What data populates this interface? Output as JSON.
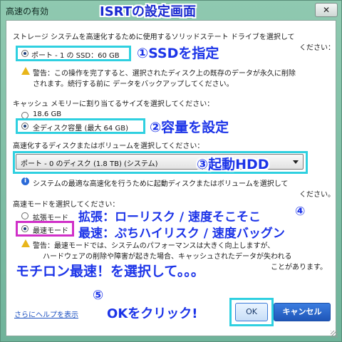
{
  "window": {
    "title": "高速の有効",
    "close_glyph": "✕"
  },
  "annotations": {
    "page_title": "ISRTの設定画面",
    "step1": "①SSDを指定",
    "step2": "②容量を設定",
    "step3": "③起動HDD",
    "step4": "④",
    "expansion_note": "拡張：ローリスク / 速度そこそこ",
    "fastest_note": "最速：ぷちハイリスク / 速度バッグン",
    "choose_fastest": "モチロン最速！を選択して。。。",
    "step5": "⑤",
    "click_ok": "OKをクリック!"
  },
  "section_ssd": {
    "prompt_line1": "ストレージ システムを高速化するために使用するソリッドステート ドライブを選択して",
    "prompt_line2": "ください：",
    "option": "ポート - 1 の SSD：60 GB",
    "warning_line1": "警告：この操作を完了すると、選択されたディスク上の既存のデータが永久に削除",
    "warning_line2": "されます。続行する前に データをバックアップしてください。"
  },
  "section_size": {
    "prompt": "キャッシュ メモリーに割り当てるサイズを選択してください：",
    "option_small": "18.6 GB",
    "option_full": "全ディスク容量 (最大 64 GB)"
  },
  "section_volume": {
    "prompt": "高速化するディスクまたはボリュームを選択してください：",
    "selected": "ポート - 0 のディスク (1.8 TB) (システム)",
    "info_line1": "システムの最適な高速化を行うために起動ディスクまたはボリュームを選択して",
    "info_line2": "ください。"
  },
  "section_mode": {
    "prompt": "高速モードを選択してください：",
    "option_enhanced": "拡張モード",
    "option_maximized": "最速モード",
    "warning_line1": "警告：最速モードでは、システムのパフォーマンスは大きく向上しますが、",
    "warning_line2": "ハードウェアの削除や障害が起きた場合、キャッシュされたデータが失われる",
    "warning_line3": "ことがあります。"
  },
  "footer": {
    "help_link": "さらにヘルプを表示",
    "ok": "OK",
    "cancel": "キャンセル"
  },
  "colors": {
    "annotation_blue": "#1c34e8",
    "highlight_cyan": "#2fd0e0",
    "highlight_magenta": "#d030c8"
  }
}
